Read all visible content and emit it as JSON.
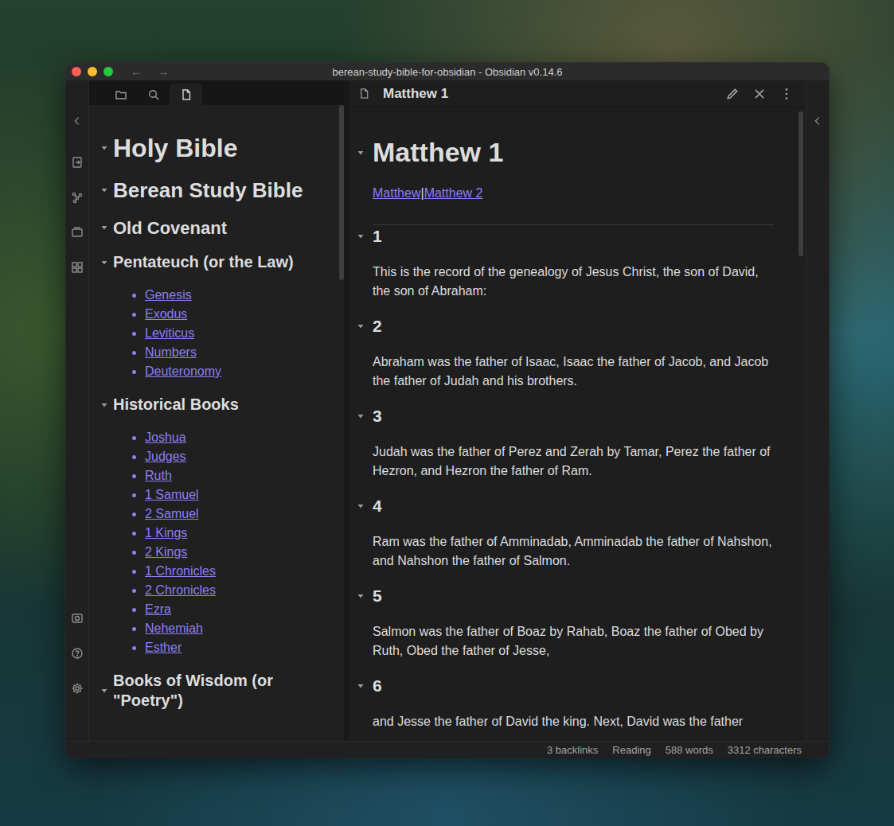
{
  "window": {
    "title": "berean-study-bible-for-obsidian - Obsidian v0.14.6",
    "nav": [
      "←",
      "→"
    ]
  },
  "sidebar": {
    "tabs": [
      {
        "kind": "folder",
        "selected": false
      },
      {
        "kind": "search",
        "selected": false
      },
      {
        "kind": "file",
        "selected": true
      }
    ],
    "sections": [
      {
        "title": "Holy Bible",
        "level": 1,
        "expanded": true,
        "items": []
      },
      {
        "title": "Berean Study Bible",
        "level": 2,
        "expanded": true,
        "items": []
      },
      {
        "title": "Old Covenant",
        "level": 3,
        "expanded": true,
        "items": []
      },
      {
        "title": "Pentateuch (or the Law)",
        "level": 4,
        "expanded": true,
        "items": [
          "Genesis",
          "Exodus",
          "Leviticus",
          "Numbers",
          "Deuteronomy"
        ]
      },
      {
        "title": "Historical Books",
        "level": 4,
        "expanded": true,
        "items": [
          "Joshua",
          "Judges",
          "Ruth",
          "1 Samuel",
          "2 Samuel",
          "1 Kings",
          "2 Kings",
          "1 Chronicles",
          "2 Chronicles",
          "Ezra",
          "Nehemiah",
          "Esther"
        ]
      },
      {
        "title": "Books of Wisdom (or \"Poetry\")",
        "level": 4,
        "expanded": true,
        "items": []
      }
    ]
  },
  "editor": {
    "tab_title": "Matthew 1",
    "heading": "Matthew 1",
    "heading_expanded": true,
    "links": [
      "Matthew",
      "Matthew 2"
    ],
    "separator": "|",
    "verses": [
      {
        "number": "1",
        "expanded": true,
        "text": "This is the record of the genealogy of Jesus Christ, the son of David, the son of Abraham:"
      },
      {
        "number": "2",
        "expanded": true,
        "text": "Abraham was the father of Isaac, Isaac the father of Jacob, and Jacob the father of Judah and his brothers."
      },
      {
        "number": "3",
        "expanded": true,
        "text": "Judah was the father of Perez and Zerah by Tamar, Perez the father of Hezron, and Hezron the father of Ram."
      },
      {
        "number": "4",
        "expanded": true,
        "text": "Ram was the father of Amminadab, Amminadab the father of Nahshon, and Nahshon the father of Salmon."
      },
      {
        "number": "5",
        "expanded": true,
        "text": "Salmon was the father of Boaz by Rahab, Boaz the father of Obed by Ruth, Obed the father of Jesse,"
      },
      {
        "number": "6",
        "expanded": true,
        "text": "and Jesse the father of David the king. Next, David was the father"
      }
    ]
  },
  "status_bar": [
    "3 backlinks",
    "Reading",
    "588 words",
    "3312 characters"
  ]
}
